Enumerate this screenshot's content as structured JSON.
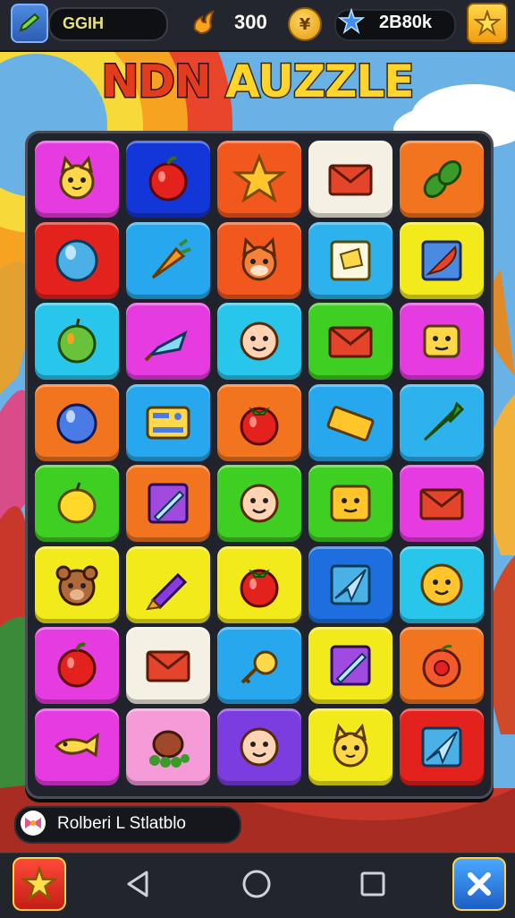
{
  "header": {
    "player_name": "GGIH",
    "coins": "300",
    "token_symbol": "¥",
    "gems": "2B80k"
  },
  "title": {
    "part1": "NDN",
    "part2": "AUZZLE"
  },
  "board": {
    "rows": [
      [
        {
          "color": "#e63be0",
          "icon": "cat-face-icon"
        },
        {
          "color": "#1336d8",
          "icon": "apple-icon"
        },
        {
          "color": "#f2581e",
          "icon": "star-icon"
        },
        {
          "color": "#f5f0e4",
          "icon": "envelope-icon"
        },
        {
          "color": "#f2741e",
          "icon": "leaf-icon"
        }
      ],
      [
        {
          "color": "#e3221d",
          "icon": "balloon-icon"
        },
        {
          "color": "#27a8ee",
          "icon": "carrot-icon"
        },
        {
          "color": "#f2581e",
          "icon": "fox-face-icon"
        },
        {
          "color": "#2db2ee",
          "icon": "sticker-icon"
        },
        {
          "color": "#f2ea1a",
          "icon": "feather-icon"
        }
      ],
      [
        {
          "color": "#29c6ec",
          "icon": "lime-icon"
        },
        {
          "color": "#e63be0",
          "icon": "ice-pop-icon"
        },
        {
          "color": "#29c6ec",
          "icon": "smiley-face-icon"
        },
        {
          "color": "#3fce22",
          "icon": "envelope-icon"
        },
        {
          "color": "#e63be0",
          "icon": "robot-face-icon"
        }
      ],
      [
        {
          "color": "#f2741e",
          "icon": "blue-ball-icon"
        },
        {
          "color": "#27a8ee",
          "icon": "radio-icon"
        },
        {
          "color": "#f2741e",
          "icon": "tomato-icon"
        },
        {
          "color": "#27a8ee",
          "icon": "ticket-icon"
        },
        {
          "color": "#2db2ee",
          "icon": "arrow-icon"
        }
      ],
      [
        {
          "color": "#3fce22",
          "icon": "lemon-icon"
        },
        {
          "color": "#f2741e",
          "icon": "pencil-icon"
        },
        {
          "color": "#3fce22",
          "icon": "smiley-face-icon"
        },
        {
          "color": "#3fce22",
          "icon": "cracker-icon"
        },
        {
          "color": "#e63be0",
          "icon": "envelope-icon"
        }
      ],
      [
        {
          "color": "#f2ea1a",
          "icon": "bear-face-icon"
        },
        {
          "color": "#f2ea1a",
          "icon": "crayon-icon"
        },
        {
          "color": "#f2ea1a",
          "icon": "tomato-icon"
        },
        {
          "color": "#1d6fe0",
          "icon": "paper-plane-icon"
        },
        {
          "color": "#29c6ec",
          "icon": "flower-face-icon"
        }
      ],
      [
        {
          "color": "#e63be0",
          "icon": "apple-icon"
        },
        {
          "color": "#f5f0e4",
          "icon": "envelope-icon"
        },
        {
          "color": "#27a8ee",
          "icon": "key-icon"
        },
        {
          "color": "#f2ea1a",
          "icon": "pencil-icon"
        },
        {
          "color": "#f2741e",
          "icon": "peach-icon"
        }
      ],
      [
        {
          "color": "#e63be0",
          "icon": "fish-icon"
        },
        {
          "color": "#f59bd8",
          "icon": "berry-bush-icon"
        },
        {
          "color": "#7b3ce0",
          "icon": "smiley-face-icon"
        },
        {
          "color": "#f2ea1a",
          "icon": "cat-face-icon"
        },
        {
          "color": "#e3221d",
          "icon": "paper-plane-icon"
        }
      ]
    ]
  },
  "status": {
    "text": "Rolberi L Stlatblo"
  },
  "colors": {
    "title_red": "#e23b1d",
    "title_yellow": "#ffd52a",
    "board_bg": "#20232b"
  }
}
